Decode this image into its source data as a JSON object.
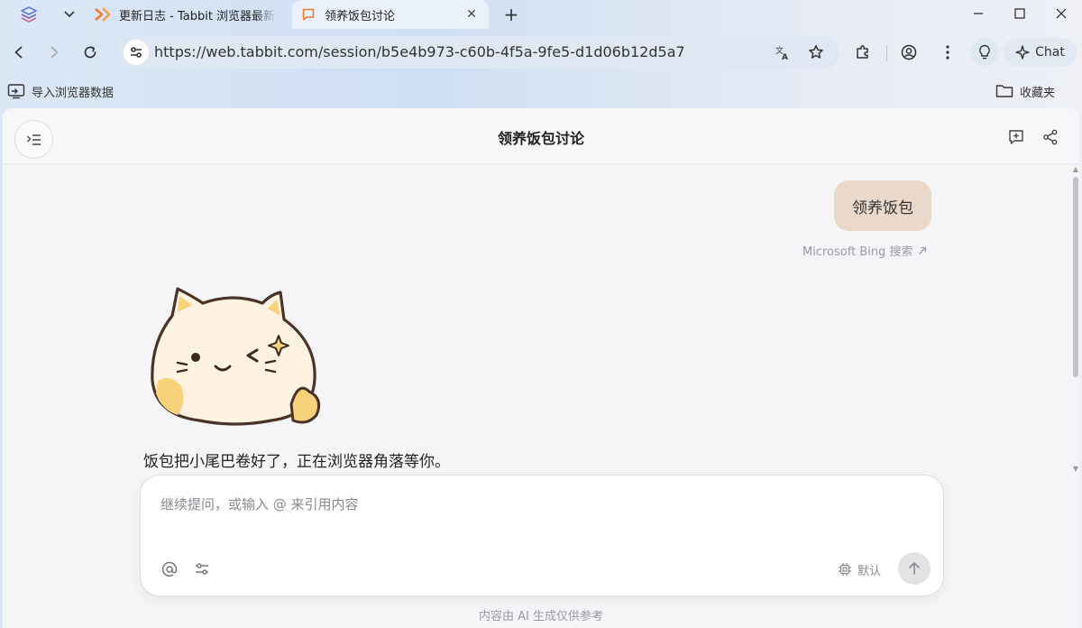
{
  "tabs": {
    "inactive_title": "更新日志 - Tabbit 浏览器最新",
    "active_title": "领养饭包讨论",
    "close_glyph": "✕",
    "new_tab_glyph": "+"
  },
  "toolbar": {
    "url": "https://web.tabbit.com/session/b5e4b973-c60b-4f5a-9fe5-d1d06b12d5a7",
    "chat_label": "Chat"
  },
  "bookmarks": {
    "import_label": "导入浏览器数据",
    "favorites_label": "收藏夹"
  },
  "page": {
    "title": "领养饭包讨论",
    "user_message": "领养饭包",
    "bing_link": "Microsoft Bing 搜索",
    "assistant_reply": "饭包把小尾巴卷好了，正在浏览器角落等你。",
    "composer_placeholder": "继续提问，或输入 @ 来引用内容",
    "model_label": "默认",
    "disclaimer": "内容由 AI 生成仅供参考"
  },
  "colors": {
    "accent_orange": "#f07b2c",
    "user_bubble": "#ead9cb",
    "cat_body": "#fdf3e0",
    "cat_patch": "#f8d27a"
  }
}
